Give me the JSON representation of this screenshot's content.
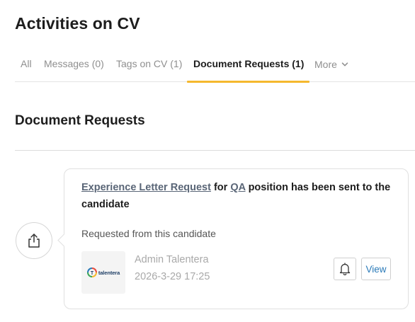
{
  "page": {
    "title": "Activities on CV"
  },
  "tabs": [
    {
      "label": "All"
    },
    {
      "label": "Messages (0)"
    },
    {
      "label": "Tags on CV (1)"
    },
    {
      "label": "Document Requests (1)",
      "active": true
    },
    {
      "label": "More",
      "icon": "chevron-down-icon"
    }
  ],
  "section": {
    "title": "Document Requests"
  },
  "activity": {
    "share_icon": "share-upload-icon",
    "request_link": "Experience Letter Request",
    "text_for": " for ",
    "position_link": "QA",
    "text_rest": " position has been sent to the candidate",
    "requested_from": "Requested from this candidate",
    "logo_text": "talentera",
    "admin_name": "Admin Talentera",
    "timestamp": "2026-3-29 17:25",
    "bell_icon": "bell-icon",
    "view_label": "View"
  },
  "colors": {
    "accent_underline": "#f5b82e",
    "link": "#5a6677",
    "view_text": "#2a7ab8"
  }
}
